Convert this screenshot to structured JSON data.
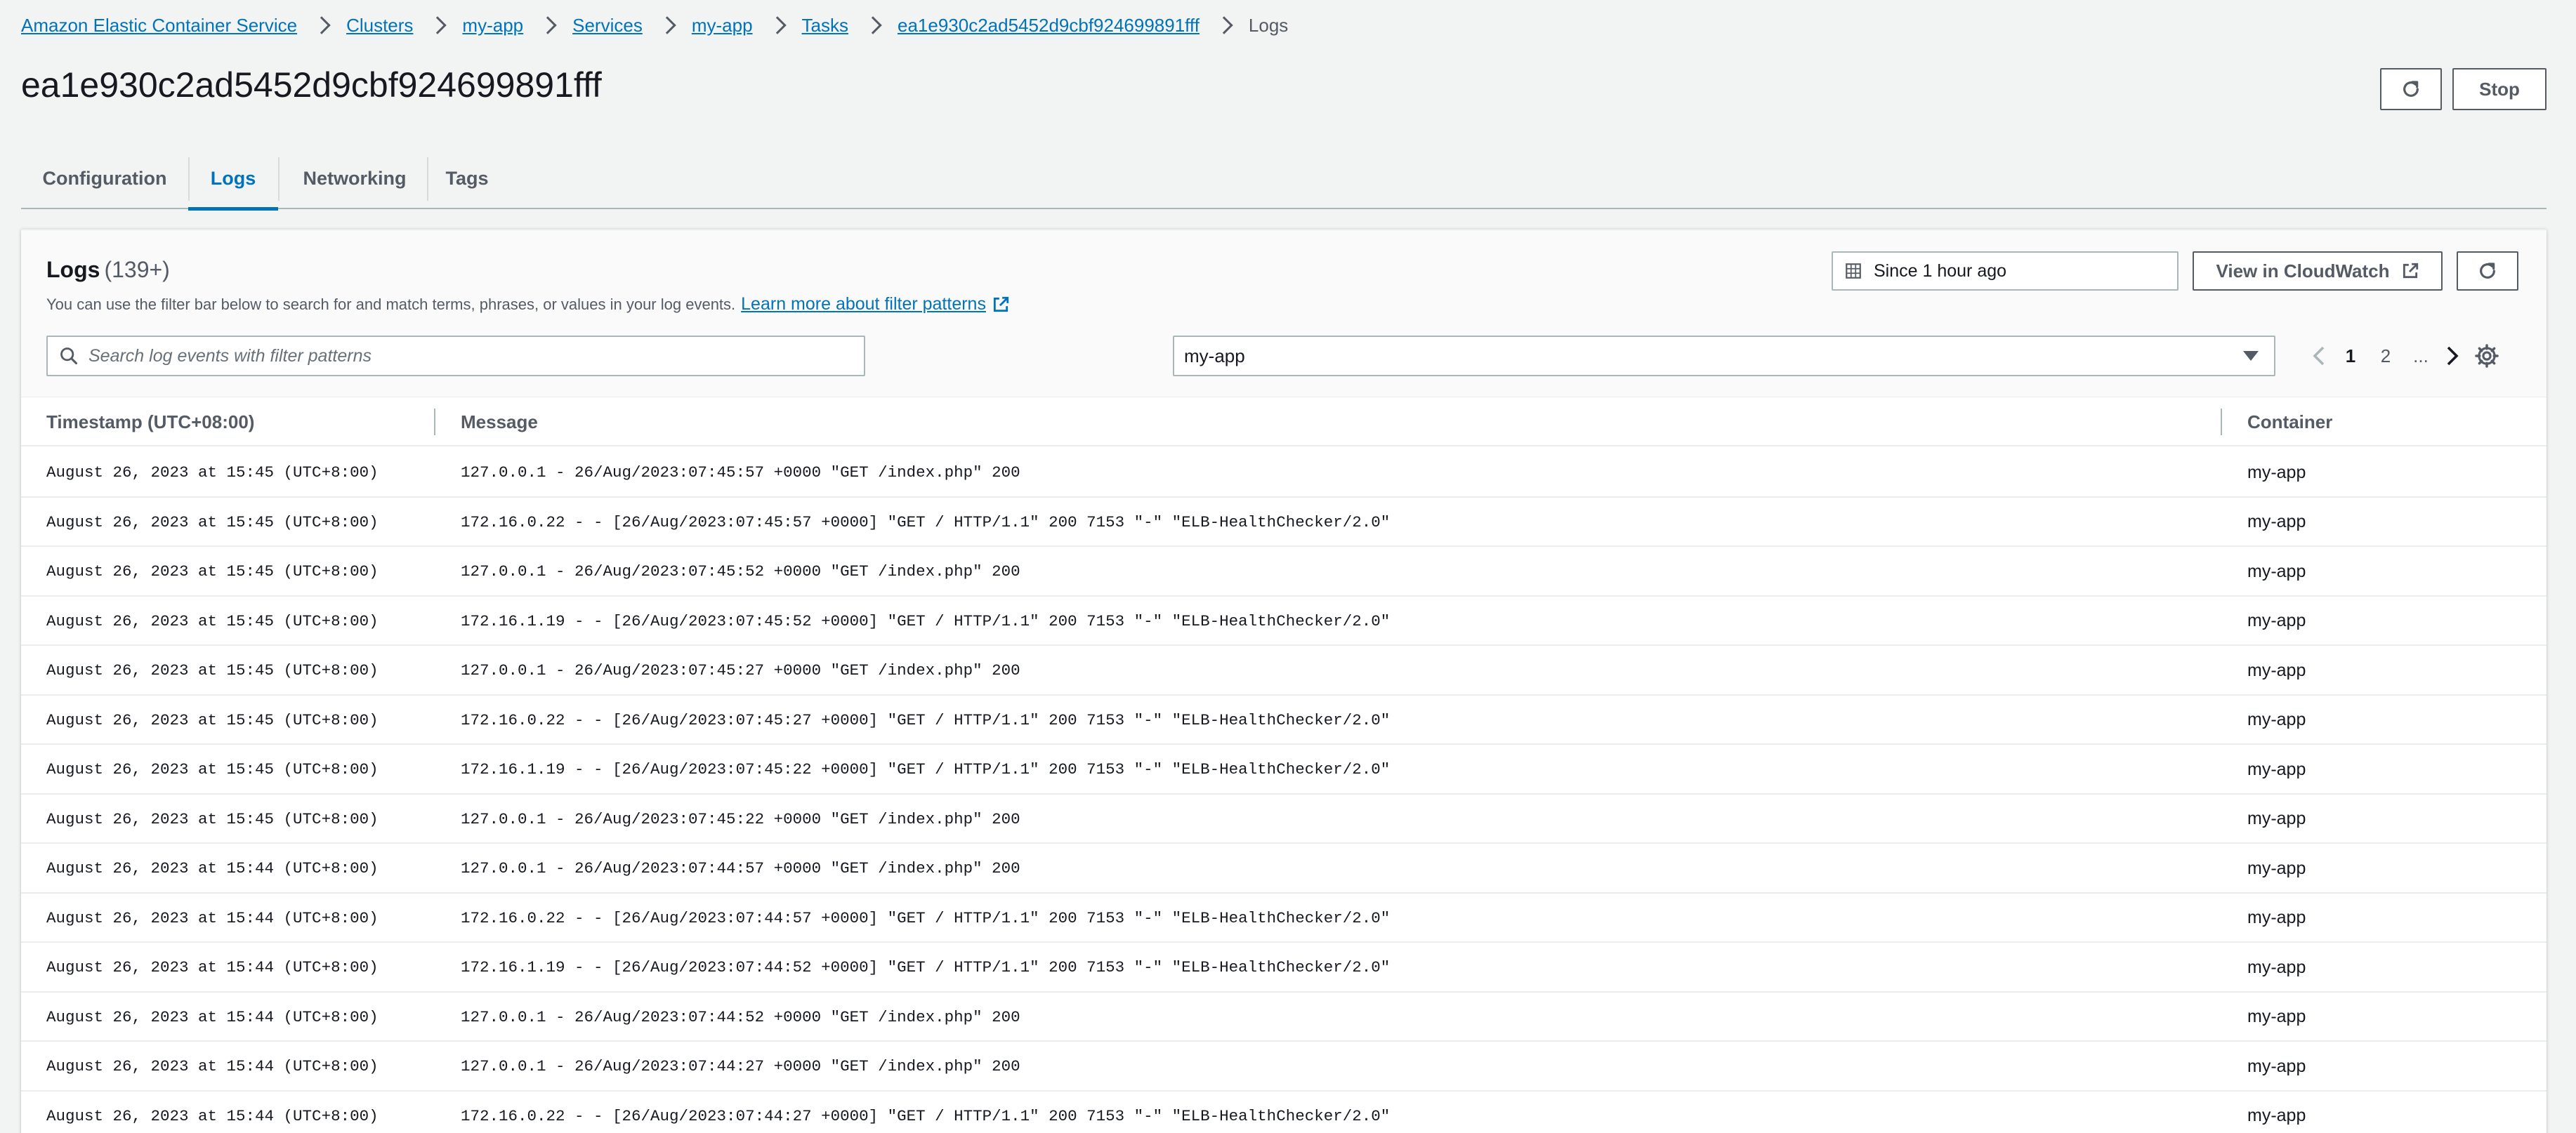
{
  "breadcrumb": {
    "items": [
      {
        "label": "Amazon Elastic Container Service"
      },
      {
        "label": "Clusters"
      },
      {
        "label": "my-app"
      },
      {
        "label": "Services"
      },
      {
        "label": "my-app"
      },
      {
        "label": "Tasks"
      },
      {
        "label": "ea1e930c2ad5452d9cbf924699891fff"
      }
    ],
    "current": "Logs"
  },
  "page": {
    "title": "ea1e930c2ad5452d9cbf924699891fff",
    "stop_label": "Stop"
  },
  "tabs": [
    {
      "label": "Configuration"
    },
    {
      "label": "Logs",
      "active": true
    },
    {
      "label": "Networking"
    },
    {
      "label": "Tags"
    }
  ],
  "logs": {
    "title": "Logs",
    "count": "(139+)",
    "description": "You can use the filter bar below to search for and match terms, phrases, or values in your log events.",
    "learn_more": "Learn more about filter patterns",
    "time_range": "Since 1 hour ago",
    "cloudwatch_label": "View in CloudWatch",
    "search_placeholder": "Search log events with filter patterns",
    "container_select": "my-app",
    "pagination": {
      "pages": [
        "1",
        "2",
        "..."
      ],
      "current": "1"
    }
  },
  "table": {
    "columns": [
      "Timestamp (UTC+08:00)",
      "Message",
      "Container"
    ],
    "rows": [
      {
        "timestamp": "August 26, 2023 at 15:45 (UTC+8:00)",
        "message": "127.0.0.1 - 26/Aug/2023:07:45:57 +0000 \"GET /index.php\" 200",
        "container": "my-app"
      },
      {
        "timestamp": "August 26, 2023 at 15:45 (UTC+8:00)",
        "message": "172.16.0.22 - - [26/Aug/2023:07:45:57 +0000] \"GET / HTTP/1.1\" 200 7153 \"-\" \"ELB-HealthChecker/2.0\"",
        "container": "my-app"
      },
      {
        "timestamp": "August 26, 2023 at 15:45 (UTC+8:00)",
        "message": "127.0.0.1 - 26/Aug/2023:07:45:52 +0000 \"GET /index.php\" 200",
        "container": "my-app"
      },
      {
        "timestamp": "August 26, 2023 at 15:45 (UTC+8:00)",
        "message": "172.16.1.19 - - [26/Aug/2023:07:45:52 +0000] \"GET / HTTP/1.1\" 200 7153 \"-\" \"ELB-HealthChecker/2.0\"",
        "container": "my-app"
      },
      {
        "timestamp": "August 26, 2023 at 15:45 (UTC+8:00)",
        "message": "127.0.0.1 - 26/Aug/2023:07:45:27 +0000 \"GET /index.php\" 200",
        "container": "my-app"
      },
      {
        "timestamp": "August 26, 2023 at 15:45 (UTC+8:00)",
        "message": "172.16.0.22 - - [26/Aug/2023:07:45:27 +0000] \"GET / HTTP/1.1\" 200 7153 \"-\" \"ELB-HealthChecker/2.0\"",
        "container": "my-app"
      },
      {
        "timestamp": "August 26, 2023 at 15:45 (UTC+8:00)",
        "message": "172.16.1.19 - - [26/Aug/2023:07:45:22 +0000] \"GET / HTTP/1.1\" 200 7153 \"-\" \"ELB-HealthChecker/2.0\"",
        "container": "my-app"
      },
      {
        "timestamp": "August 26, 2023 at 15:45 (UTC+8:00)",
        "message": "127.0.0.1 - 26/Aug/2023:07:45:22 +0000 \"GET /index.php\" 200",
        "container": "my-app"
      },
      {
        "timestamp": "August 26, 2023 at 15:44 (UTC+8:00)",
        "message": "127.0.0.1 - 26/Aug/2023:07:44:57 +0000 \"GET /index.php\" 200",
        "container": "my-app"
      },
      {
        "timestamp": "August 26, 2023 at 15:44 (UTC+8:00)",
        "message": "172.16.0.22 - - [26/Aug/2023:07:44:57 +0000] \"GET / HTTP/1.1\" 200 7153 \"-\" \"ELB-HealthChecker/2.0\"",
        "container": "my-app"
      },
      {
        "timestamp": "August 26, 2023 at 15:44 (UTC+8:00)",
        "message": "172.16.1.19 - - [26/Aug/2023:07:44:52 +0000] \"GET / HTTP/1.1\" 200 7153 \"-\" \"ELB-HealthChecker/2.0\"",
        "container": "my-app"
      },
      {
        "timestamp": "August 26, 2023 at 15:44 (UTC+8:00)",
        "message": "127.0.0.1 - 26/Aug/2023:07:44:52 +0000 \"GET /index.php\" 200",
        "container": "my-app"
      },
      {
        "timestamp": "August 26, 2023 at 15:44 (UTC+8:00)",
        "message": "127.0.0.1 - 26/Aug/2023:07:44:27 +0000 \"GET /index.php\" 200",
        "container": "my-app"
      },
      {
        "timestamp": "August 26, 2023 at 15:44 (UTC+8:00)",
        "message": "172.16.0.22 - - [26/Aug/2023:07:44:27 +0000] \"GET / HTTP/1.1\" 200 7153 \"-\" \"ELB-HealthChecker/2.0\"",
        "container": "my-app"
      }
    ]
  },
  "colors": {
    "link": "#0073bb",
    "text": "#16191f",
    "secondary": "#545b64",
    "border": "#aab7b8",
    "background": "#f2f3f3"
  }
}
